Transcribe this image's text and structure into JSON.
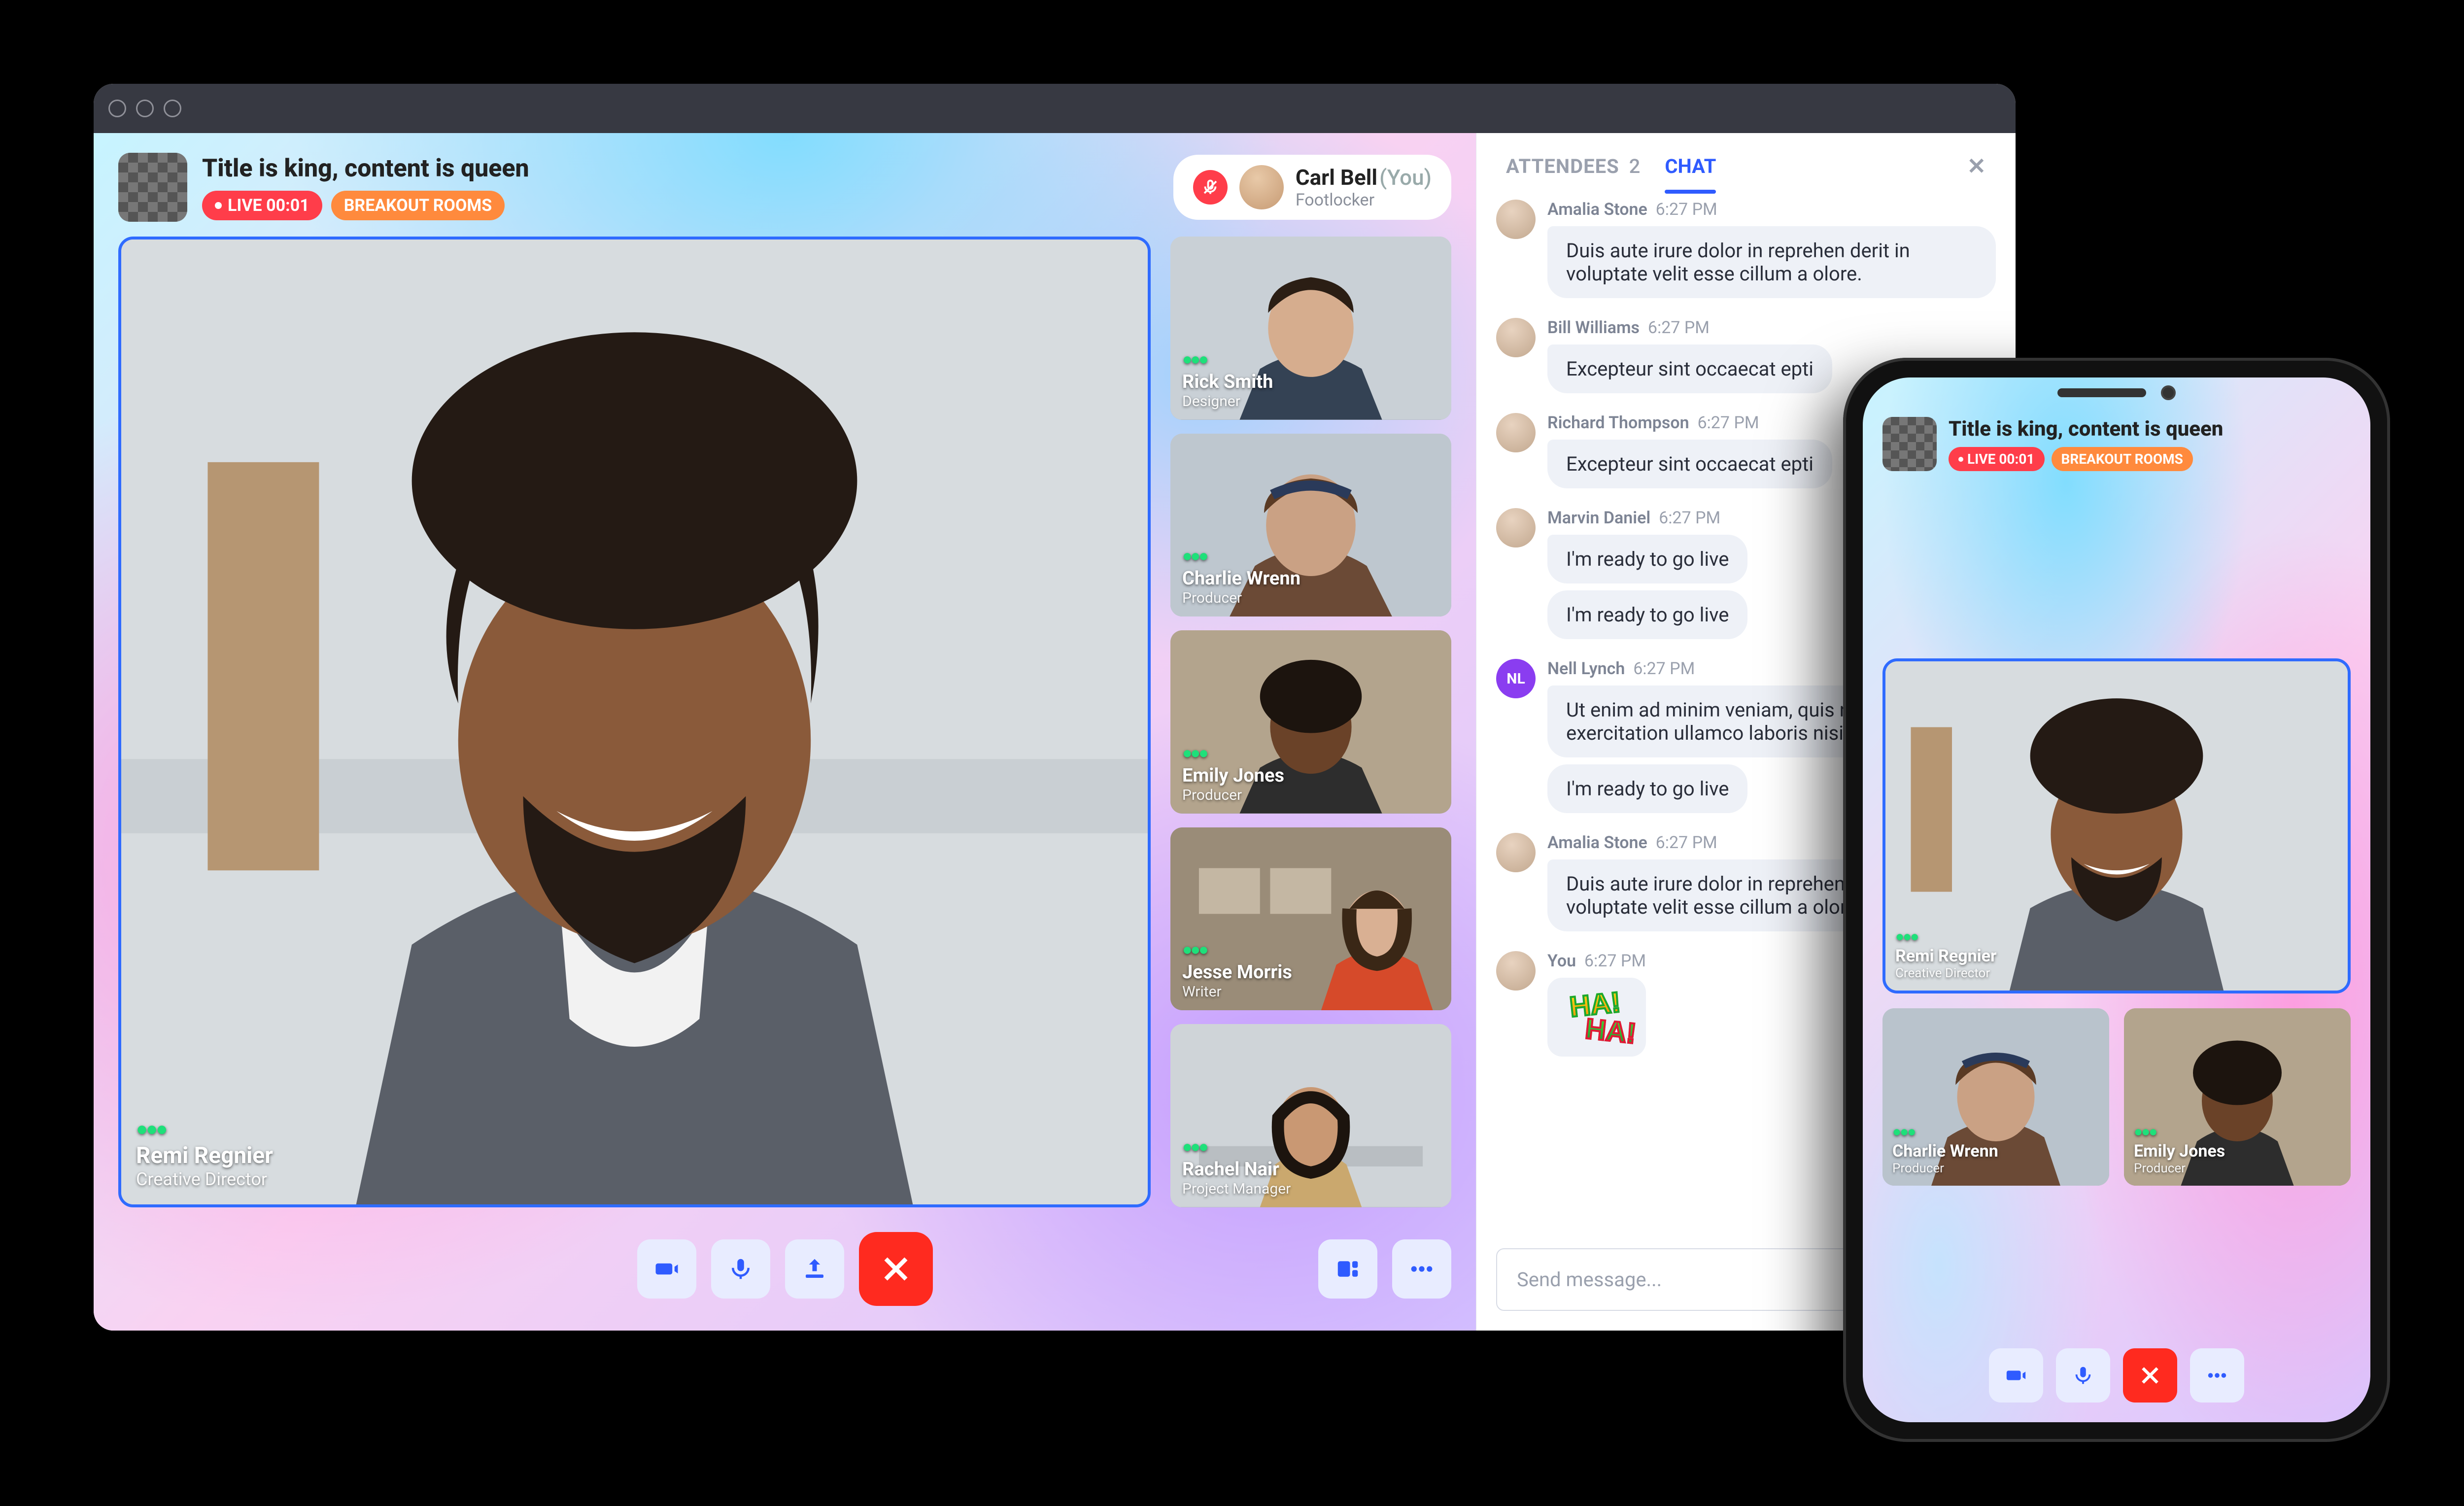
{
  "room": {
    "title": "Title is king, content is queen",
    "live_label": "LIVE 00:01",
    "breakout_label": "BREAKOUT ROOMS"
  },
  "self": {
    "name": "Carl Bell",
    "you_suffix": "(You)",
    "subtitle": "Footlocker"
  },
  "main_tile": {
    "name": "Remi Regnier",
    "role": "Creative Director"
  },
  "side_tiles": [
    {
      "name": "Rick Smith",
      "role": "Designer"
    },
    {
      "name": "Charlie Wrenn",
      "role": "Producer"
    },
    {
      "name": "Emily Jones",
      "role": "Producer"
    },
    {
      "name": "Jesse Morris",
      "role": "Writer"
    },
    {
      "name": "Rachel Nair",
      "role": "Project Manager"
    }
  ],
  "sidebar": {
    "attendees_label": "ATTENDEES",
    "attendees_count": "2",
    "chat_label": "CHAT"
  },
  "messages": [
    {
      "author": "Amalia Stone",
      "time": "6:27 PM",
      "bubbles": [
        "Duis aute irure dolor in reprehen derit in voluptate velit esse cillum a olore."
      ]
    },
    {
      "author": "Bill Williams",
      "time": "6:27 PM",
      "bubbles": [
        "Excepteur sint occaecat epti"
      ]
    },
    {
      "author": "Richard Thompson",
      "time": "6:27 PM",
      "bubbles": [
        "Excepteur sint occaecat epti"
      ]
    },
    {
      "author": "Marvin Daniel",
      "time": "6:27 PM",
      "bubbles": [
        "I'm ready to go live",
        "I'm ready to go live"
      ]
    },
    {
      "author": "Nell Lynch",
      "time": "6:27 PM",
      "initials": "NL",
      "bubbles": [
        "Ut enim ad minim veniam, quis nostrud exercitation ullamco laboris nisi.",
        "I'm ready to go live"
      ]
    },
    {
      "author": "Amalia Stone",
      "time": "6:27 PM",
      "bubbles": [
        "Duis aute irure dolor in reprehen derit in voluptate velit esse cillum a olore."
      ]
    },
    {
      "author": "You",
      "time": "6:27 PM",
      "sticker": true
    }
  ],
  "composer": {
    "placeholder": "Send message..."
  },
  "sticker": {
    "line1": "HA!",
    "line2": "HA!"
  },
  "mobile": {
    "title": "Title is king, content is queen",
    "live_label": "LIVE 00:01",
    "breakout_label": "BREAKOUT ROOMS",
    "main": {
      "name": "Remi Regnier",
      "role": "Creative Director"
    },
    "left": {
      "name": "Charlie Wrenn",
      "role": "Producer"
    },
    "right": {
      "name": "Emily Jones",
      "role": "Producer"
    }
  }
}
